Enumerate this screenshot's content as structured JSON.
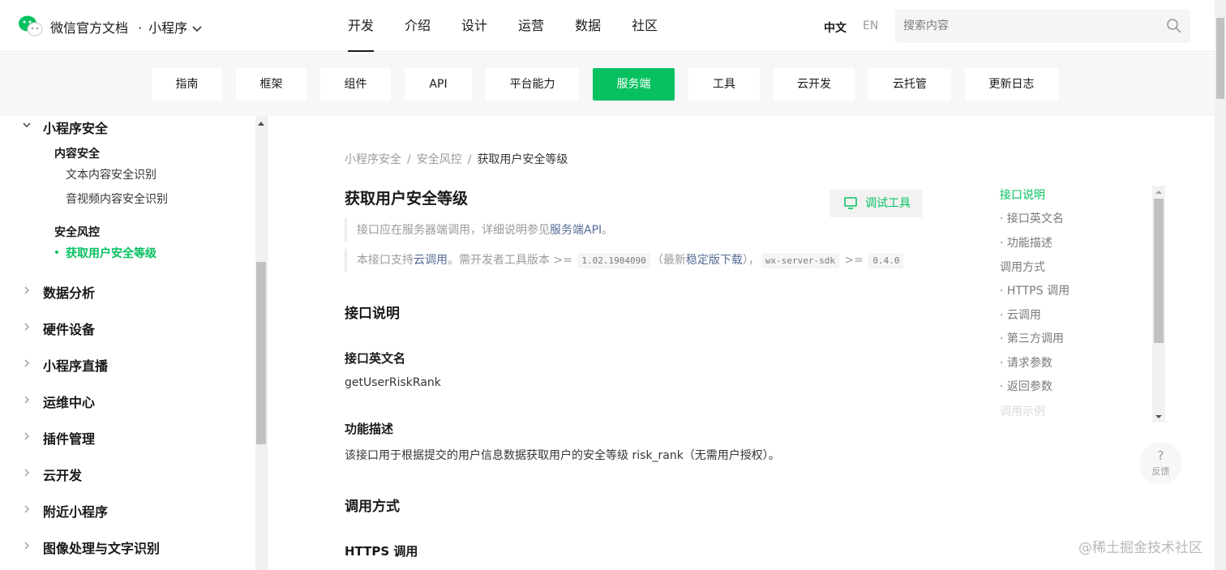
{
  "header": {
    "site_name": "微信官方文档",
    "dot": "·",
    "product": "小程序",
    "nav": [
      "开发",
      "介绍",
      "设计",
      "运营",
      "数据",
      "社区"
    ],
    "lang_zh": "中文",
    "lang_en": "EN",
    "search_placeholder": "搜索内容"
  },
  "subnav": [
    "指南",
    "框架",
    "组件",
    "API",
    "平台能力",
    "服务端",
    "工具",
    "云开发",
    "云托管",
    "更新日志"
  ],
  "sidebar": {
    "group_open": "小程序安全",
    "sub1": "内容安全",
    "sub1_items": [
      "文本内容安全识别",
      "音视频内容安全识别"
    ],
    "sub2": "安全风控",
    "active_item": "获取用户安全等级",
    "groups": [
      "数据分析",
      "硬件设备",
      "小程序直播",
      "运维中心",
      "插件管理",
      "云开发",
      "附近小程序",
      "图像处理与文字识别"
    ]
  },
  "breadcrumb": [
    "小程序安全",
    "安全风控",
    "获取用户安全等级"
  ],
  "crumb_sep": "/",
  "page": {
    "title": "获取用户安全等级",
    "debug_button": "调试工具",
    "note1_prefix": "接口应在服务器端调用，详细说明参见",
    "note1_link": "服务端API",
    "note1_suffix": "。",
    "note2_prefix": "本接口支持",
    "note2_link1": "云调用",
    "note2_mid1": "。需开发者工具版本 >= ",
    "note2_code1": "1.02.1904090",
    "note2_mid2": "（最新",
    "note2_link2": "稳定版下载",
    "note2_mid3": "），",
    "note2_code2": "wx-server-sdk",
    "note2_mid4": " >= ",
    "note2_code3": "0.4.0",
    "sec1": "接口说明",
    "sub_name": "接口英文名",
    "api_name": "getUserRiskRank",
    "sub_desc": "功能描述",
    "desc": "该接口用于根据提交的用户信息数据获取用户的安全等级 risk_rank（无需用户授权）。",
    "sec2": "调用方式",
    "sub_https": "HTTPS 调用"
  },
  "toc": [
    "接口说明",
    "· 接口英文名",
    "· 功能描述",
    "调用方式",
    "· HTTPS 调用",
    "· 云调用",
    "· 第三方调用",
    "· 请求参数",
    "· 返回参数",
    "调用示例"
  ],
  "feedback": {
    "icon": "?",
    "label": "反馈"
  },
  "watermark": "@稀土掘金技术社区",
  "colors": {
    "accent": "#07c160",
    "link": "#576b95"
  }
}
